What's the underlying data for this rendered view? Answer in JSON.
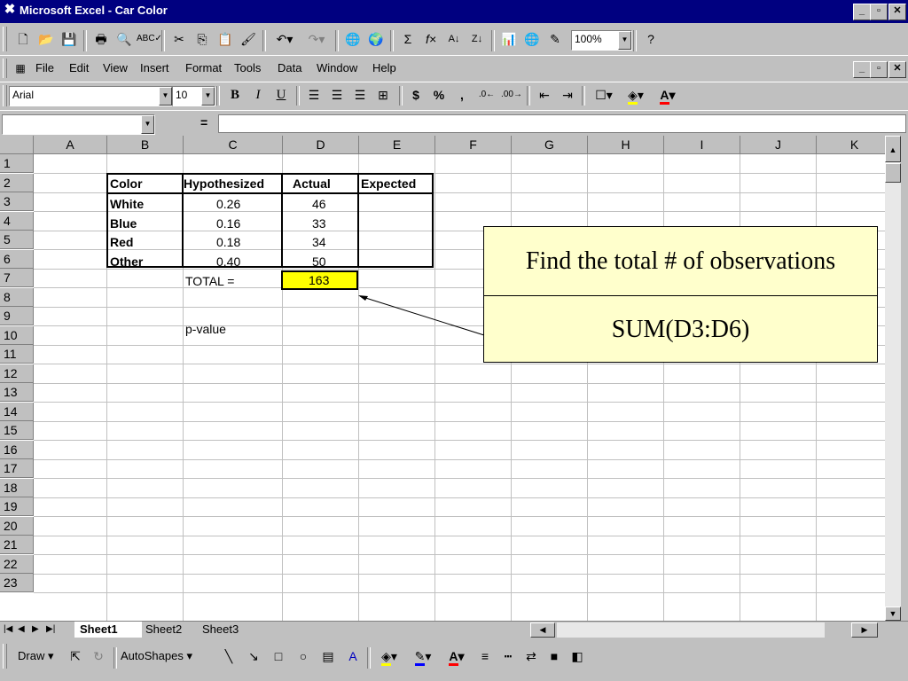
{
  "window": {
    "title": "Microsoft Excel - Car  Color",
    "app_icon": "excel-icon",
    "min": "_",
    "restore": "▫",
    "close": "✕"
  },
  "menu": {
    "items": [
      "File",
      "Edit",
      "View",
      "Insert",
      "Format",
      "Tools",
      "Data",
      "Window",
      "Help"
    ]
  },
  "toolbar": {
    "zoom": "100%"
  },
  "format": {
    "font": "Arial",
    "size": "10",
    "bold": "B",
    "italic": "I",
    "underline": "U",
    "currency": "$",
    "percent": "%",
    "comma": ","
  },
  "formula_bar": {
    "name_box": "",
    "equals": "=",
    "content": ""
  },
  "grid": {
    "columns": [
      "A",
      "B",
      "C",
      "D",
      "E",
      "F",
      "G",
      "H",
      "I",
      "J",
      "K"
    ],
    "rows": [
      "1",
      "2",
      "3",
      "4",
      "5",
      "6",
      "7",
      "8",
      "9",
      "10",
      "11",
      "12",
      "13",
      "14",
      "15",
      "16",
      "17",
      "18",
      "19",
      "20",
      "21",
      "22",
      "23"
    ],
    "table": {
      "headers": [
        "Color",
        "Hypothesized",
        "Actual",
        "Expected"
      ],
      "rows": [
        {
          "color": "White",
          "hyp": "0.26",
          "actual": "46",
          "expected": ""
        },
        {
          "color": "Blue",
          "hyp": "0.16",
          "actual": "33",
          "expected": ""
        },
        {
          "color": "Red",
          "hyp": "0.18",
          "actual": "34",
          "expected": ""
        },
        {
          "color": "Other",
          "hyp": "0.40",
          "actual": "50",
          "expected": ""
        }
      ],
      "total_label": "TOTAL =",
      "total_value": "163",
      "pvalue_label": "p-value"
    },
    "highlight_color": "#ffff00"
  },
  "sheets": [
    "Sheet1",
    "Sheet2",
    "Sheet3"
  ],
  "active_sheet": "Sheet1",
  "drawbar": {
    "draw": "Draw",
    "autoshapes": "AutoShapes"
  },
  "callout": {
    "title": "Find the total # of observations",
    "formula": "SUM(D3:D6)"
  }
}
